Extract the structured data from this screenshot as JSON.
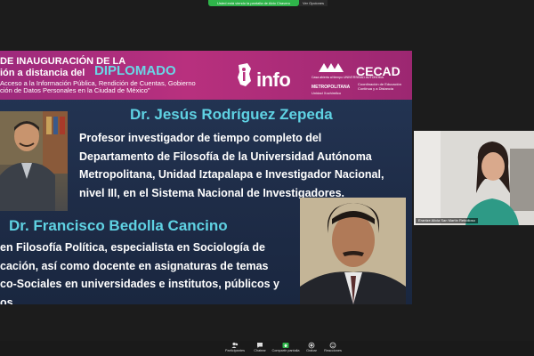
{
  "share_bar": {
    "text": "Usted está viendo la pantalla de Aldo Chavero"
  },
  "view_options": {
    "text": "Ver Opciones"
  },
  "banner": {
    "line1": "DE INAUGURACIÓN DE LA",
    "line2": "ión a distancia del",
    "diplomado": "DIPLOMADO",
    "line3": "Acceso a la Información Pública, Rendición de Cuentas, Gobierno",
    "line4": "ción de Datos Personales en la Ciudad de México\"",
    "line5": ""
  },
  "logos": {
    "info": "info",
    "uam_small": "Casa abierta al tiempo UNIVERSIDAD AUTÓNOMA",
    "uam_main": "METROPOLITANA",
    "uam_unit": "Unidad Xochimilco",
    "cecad": "CECAD",
    "cecad_sub1": "Coordinación de Educación",
    "cecad_sub2": "Continua y a Distancia"
  },
  "speaker1": {
    "name": "Dr. Jesús Rodríguez Zepeda",
    "bio_lines": [
      "Profesor investigador de tiempo completo del",
      "Departamento de Filosofía de la Universidad Autónoma",
      "Metropolitana, Unidad Iztapalapa e Investigador Nacional,",
      "nivel III, en el Sistema Nacional de Investigadores."
    ]
  },
  "speaker2": {
    "name": "Dr. Francisco Bedolla Cancino",
    "bio_lines": [
      "en Filosofía Política, especialista en Sociología de",
      "cación, así como docente en asignaturas de temas",
      "co-Sociales en universidades e institutos, públicos y",
      "os."
    ]
  },
  "participant": {
    "name": "Erantze Alicia San Martín Rebolloso"
  },
  "toolbar": {
    "participants": "Participantes",
    "participants_count": "50",
    "chat": "Chatear",
    "share_screen": "Compartir pantalla",
    "record": "Grabar",
    "reactions": "Reacciones"
  },
  "colors": {
    "banner": "#b8307e",
    "accent_name": "#5fd2e3",
    "slide_bg": "#22324f",
    "share_green": "#2fb44a"
  }
}
